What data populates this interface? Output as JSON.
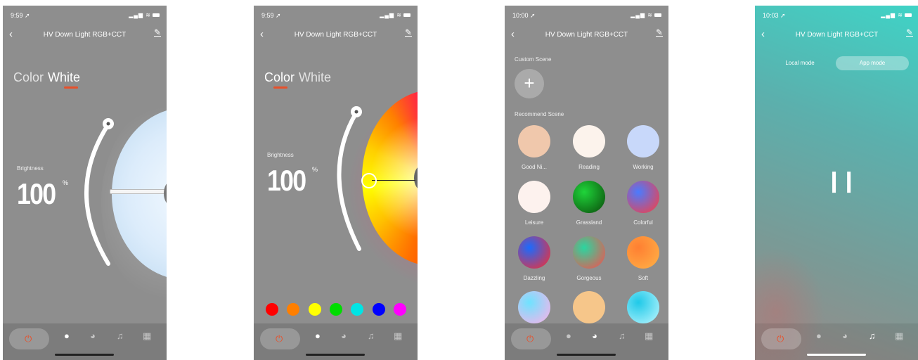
{
  "screens": [
    {
      "status": {
        "time": "9:59 ➚",
        "icons": "▂▄▆ ≋"
      },
      "nav": {
        "back": "‹",
        "title": "HV Down Light RGB+CCT",
        "edit": "✎"
      },
      "tabs": [
        "Color",
        "White"
      ],
      "active_tab": "White",
      "brightness_label": "Brightness",
      "brightness_value": "100",
      "brightness_unit": "%",
      "brightness_level": 1.0
    },
    {
      "status": {
        "time": "9:59 ➚",
        "icons": "▂▄▆ ≋"
      },
      "nav": {
        "back": "‹",
        "title": "HV Down Light RGB+CCT",
        "edit": "✎"
      },
      "tabs": [
        "Color",
        "White"
      ],
      "active_tab": "Color",
      "brightness_label": "Brightness",
      "brightness_value": "100",
      "brightness_unit": "%",
      "brightness_level": 1.0,
      "preset_colors": [
        "#ff0000",
        "#ff7f00",
        "#ffff00",
        "#00dd00",
        "#00e5e5",
        "#0000ff",
        "#ff00ff"
      ]
    },
    {
      "status": {
        "time": "10:00 ➚",
        "icons": "▂▄▆ ≋"
      },
      "nav": {
        "back": "‹",
        "title": "HV Down Light RGB+CCT",
        "edit": "✎"
      },
      "custom_label": "Custom Scene",
      "add_symbol": "+",
      "recommend_label": "Recommend Scene",
      "scenes": [
        {
          "name": "Good Ni...",
          "colors": [
            "#f0c8ac",
            "#f0c8ac"
          ]
        },
        {
          "name": "Reading",
          "colors": [
            "#fcf3ec",
            "#fcf3ec"
          ]
        },
        {
          "name": "Working",
          "colors": [
            "#c8d8fa",
            "#c8d8fa"
          ]
        },
        {
          "name": "Leisure",
          "colors": [
            "#fdf2ee",
            "#fdf2ee"
          ]
        },
        {
          "name": "Grassland",
          "colors": [
            "#0a4a0a",
            "#1fd43a"
          ]
        },
        {
          "name": "Colorful",
          "colors": [
            "#ff3b3b",
            "#4a7bff"
          ]
        },
        {
          "name": "Dazzling",
          "colors": [
            "#ff2a2a",
            "#1a6bff"
          ]
        },
        {
          "name": "Gorgeous",
          "colors": [
            "#ff4a4a",
            "#2ad6a0"
          ]
        },
        {
          "name": "Soft",
          "colors": [
            "#ffb347",
            "#ff7f32"
          ]
        },
        {
          "name": "",
          "colors": [
            "#ffb0e8",
            "#6ee3ff"
          ]
        },
        {
          "name": "",
          "colors": [
            "#f6c68a",
            "#f6c68a"
          ]
        },
        {
          "name": "",
          "colors": [
            "#bdf6ff",
            "#1fc9e8"
          ]
        }
      ]
    },
    {
      "status": {
        "time": "10:03 ➚",
        "icons": "▂▄▆ ≋"
      },
      "nav": {
        "back": "‹",
        "title": "HV Down Light RGB+CCT",
        "edit": "✎"
      },
      "modes": [
        "Local mode",
        "App mode"
      ],
      "active_mode": "App mode",
      "pause_symbol": "❙❙"
    }
  ],
  "tabbar": {
    "power_icon": "power-icon",
    "items": [
      "bulb-icon",
      "palette-icon",
      "music-icon",
      "grid-icon"
    ],
    "glyphs": {
      "power": "⏻",
      "bulb": "●",
      "palette": "◕",
      "music": "♫",
      "grid": "▦"
    },
    "active_per_screen": [
      "bulb",
      "bulb",
      "palette",
      "music"
    ]
  }
}
